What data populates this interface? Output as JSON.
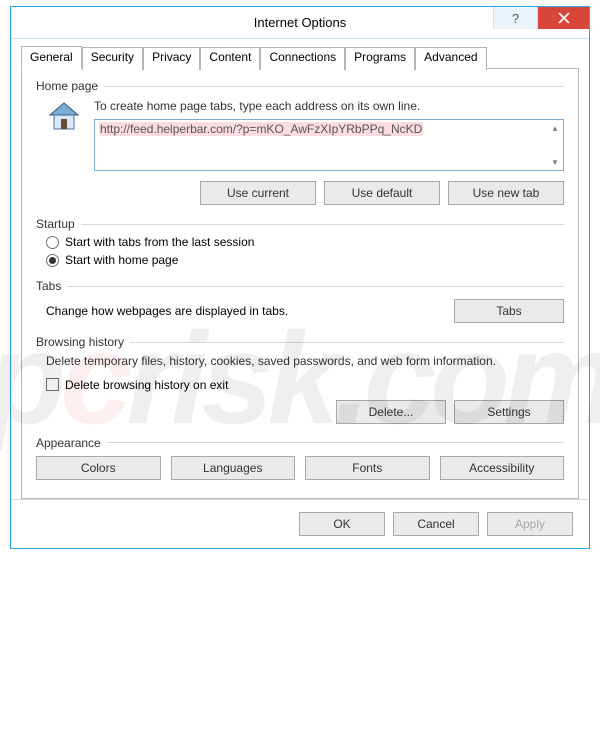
{
  "window": {
    "title": "Internet Options"
  },
  "tabs": [
    "General",
    "Security",
    "Privacy",
    "Content",
    "Connections",
    "Programs",
    "Advanced"
  ],
  "activeTab": 0,
  "home": {
    "label": "Home page",
    "desc": "To create home page tabs, type each address on its own line.",
    "url": "http://feed.helperbar.com/?p=mKO_AwFzXIpYRbPPq_NcKD",
    "btn_current": "Use current",
    "btn_default": "Use default",
    "btn_newtab": "Use new tab"
  },
  "startup": {
    "label": "Startup",
    "opt1": "Start with tabs from the last session",
    "opt2": "Start with home page",
    "selected": 1
  },
  "tabsGroup": {
    "label": "Tabs",
    "desc": "Change how webpages are displayed in tabs.",
    "btn": "Tabs"
  },
  "history": {
    "label": "Browsing history",
    "desc": "Delete temporary files, history, cookies, saved passwords, and web form information.",
    "chk": "Delete browsing history on exit",
    "btn_delete": "Delete...",
    "btn_settings": "Settings"
  },
  "appearance": {
    "label": "Appearance",
    "btn_colors": "Colors",
    "btn_lang": "Languages",
    "btn_fonts": "Fonts",
    "btn_access": "Accessibility"
  },
  "footer": {
    "ok": "OK",
    "cancel": "Cancel",
    "apply": "Apply"
  }
}
